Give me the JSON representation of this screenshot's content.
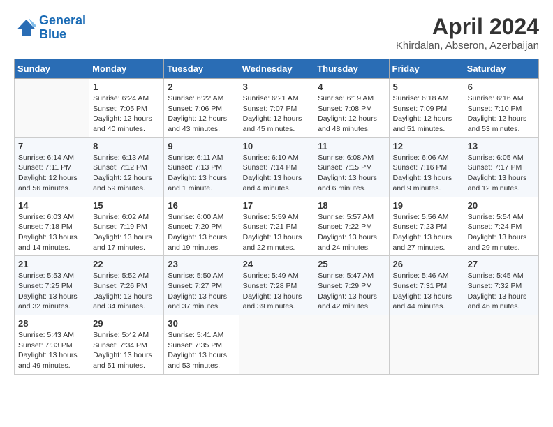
{
  "header": {
    "logo_line1": "General",
    "logo_line2": "Blue",
    "title": "April 2024",
    "subtitle": "Khirdalan, Abseron, Azerbaijan"
  },
  "calendar": {
    "days_of_week": [
      "Sunday",
      "Monday",
      "Tuesday",
      "Wednesday",
      "Thursday",
      "Friday",
      "Saturday"
    ],
    "weeks": [
      [
        {
          "day": "",
          "sunrise": "",
          "sunset": "",
          "daylight": ""
        },
        {
          "day": "1",
          "sunrise": "Sunrise: 6:24 AM",
          "sunset": "Sunset: 7:05 PM",
          "daylight": "Daylight: 12 hours and 40 minutes."
        },
        {
          "day": "2",
          "sunrise": "Sunrise: 6:22 AM",
          "sunset": "Sunset: 7:06 PM",
          "daylight": "Daylight: 12 hours and 43 minutes."
        },
        {
          "day": "3",
          "sunrise": "Sunrise: 6:21 AM",
          "sunset": "Sunset: 7:07 PM",
          "daylight": "Daylight: 12 hours and 45 minutes."
        },
        {
          "day": "4",
          "sunrise": "Sunrise: 6:19 AM",
          "sunset": "Sunset: 7:08 PM",
          "daylight": "Daylight: 12 hours and 48 minutes."
        },
        {
          "day": "5",
          "sunrise": "Sunrise: 6:18 AM",
          "sunset": "Sunset: 7:09 PM",
          "daylight": "Daylight: 12 hours and 51 minutes."
        },
        {
          "day": "6",
          "sunrise": "Sunrise: 6:16 AM",
          "sunset": "Sunset: 7:10 PM",
          "daylight": "Daylight: 12 hours and 53 minutes."
        }
      ],
      [
        {
          "day": "7",
          "sunrise": "Sunrise: 6:14 AM",
          "sunset": "Sunset: 7:11 PM",
          "daylight": "Daylight: 12 hours and 56 minutes."
        },
        {
          "day": "8",
          "sunrise": "Sunrise: 6:13 AM",
          "sunset": "Sunset: 7:12 PM",
          "daylight": "Daylight: 12 hours and 59 minutes."
        },
        {
          "day": "9",
          "sunrise": "Sunrise: 6:11 AM",
          "sunset": "Sunset: 7:13 PM",
          "daylight": "Daylight: 13 hours and 1 minute."
        },
        {
          "day": "10",
          "sunrise": "Sunrise: 6:10 AM",
          "sunset": "Sunset: 7:14 PM",
          "daylight": "Daylight: 13 hours and 4 minutes."
        },
        {
          "day": "11",
          "sunrise": "Sunrise: 6:08 AM",
          "sunset": "Sunset: 7:15 PM",
          "daylight": "Daylight: 13 hours and 6 minutes."
        },
        {
          "day": "12",
          "sunrise": "Sunrise: 6:06 AM",
          "sunset": "Sunset: 7:16 PM",
          "daylight": "Daylight: 13 hours and 9 minutes."
        },
        {
          "day": "13",
          "sunrise": "Sunrise: 6:05 AM",
          "sunset": "Sunset: 7:17 PM",
          "daylight": "Daylight: 13 hours and 12 minutes."
        }
      ],
      [
        {
          "day": "14",
          "sunrise": "Sunrise: 6:03 AM",
          "sunset": "Sunset: 7:18 PM",
          "daylight": "Daylight: 13 hours and 14 minutes."
        },
        {
          "day": "15",
          "sunrise": "Sunrise: 6:02 AM",
          "sunset": "Sunset: 7:19 PM",
          "daylight": "Daylight: 13 hours and 17 minutes."
        },
        {
          "day": "16",
          "sunrise": "Sunrise: 6:00 AM",
          "sunset": "Sunset: 7:20 PM",
          "daylight": "Daylight: 13 hours and 19 minutes."
        },
        {
          "day": "17",
          "sunrise": "Sunrise: 5:59 AM",
          "sunset": "Sunset: 7:21 PM",
          "daylight": "Daylight: 13 hours and 22 minutes."
        },
        {
          "day": "18",
          "sunrise": "Sunrise: 5:57 AM",
          "sunset": "Sunset: 7:22 PM",
          "daylight": "Daylight: 13 hours and 24 minutes."
        },
        {
          "day": "19",
          "sunrise": "Sunrise: 5:56 AM",
          "sunset": "Sunset: 7:23 PM",
          "daylight": "Daylight: 13 hours and 27 minutes."
        },
        {
          "day": "20",
          "sunrise": "Sunrise: 5:54 AM",
          "sunset": "Sunset: 7:24 PM",
          "daylight": "Daylight: 13 hours and 29 minutes."
        }
      ],
      [
        {
          "day": "21",
          "sunrise": "Sunrise: 5:53 AM",
          "sunset": "Sunset: 7:25 PM",
          "daylight": "Daylight: 13 hours and 32 minutes."
        },
        {
          "day": "22",
          "sunrise": "Sunrise: 5:52 AM",
          "sunset": "Sunset: 7:26 PM",
          "daylight": "Daylight: 13 hours and 34 minutes."
        },
        {
          "day": "23",
          "sunrise": "Sunrise: 5:50 AM",
          "sunset": "Sunset: 7:27 PM",
          "daylight": "Daylight: 13 hours and 37 minutes."
        },
        {
          "day": "24",
          "sunrise": "Sunrise: 5:49 AM",
          "sunset": "Sunset: 7:28 PM",
          "daylight": "Daylight: 13 hours and 39 minutes."
        },
        {
          "day": "25",
          "sunrise": "Sunrise: 5:47 AM",
          "sunset": "Sunset: 7:29 PM",
          "daylight": "Daylight: 13 hours and 42 minutes."
        },
        {
          "day": "26",
          "sunrise": "Sunrise: 5:46 AM",
          "sunset": "Sunset: 7:31 PM",
          "daylight": "Daylight: 13 hours and 44 minutes."
        },
        {
          "day": "27",
          "sunrise": "Sunrise: 5:45 AM",
          "sunset": "Sunset: 7:32 PM",
          "daylight": "Daylight: 13 hours and 46 minutes."
        }
      ],
      [
        {
          "day": "28",
          "sunrise": "Sunrise: 5:43 AM",
          "sunset": "Sunset: 7:33 PM",
          "daylight": "Daylight: 13 hours and 49 minutes."
        },
        {
          "day": "29",
          "sunrise": "Sunrise: 5:42 AM",
          "sunset": "Sunset: 7:34 PM",
          "daylight": "Daylight: 13 hours and 51 minutes."
        },
        {
          "day": "30",
          "sunrise": "Sunrise: 5:41 AM",
          "sunset": "Sunset: 7:35 PM",
          "daylight": "Daylight: 13 hours and 53 minutes."
        },
        {
          "day": "",
          "sunrise": "",
          "sunset": "",
          "daylight": ""
        },
        {
          "day": "",
          "sunrise": "",
          "sunset": "",
          "daylight": ""
        },
        {
          "day": "",
          "sunrise": "",
          "sunset": "",
          "daylight": ""
        },
        {
          "day": "",
          "sunrise": "",
          "sunset": "",
          "daylight": ""
        }
      ]
    ]
  }
}
